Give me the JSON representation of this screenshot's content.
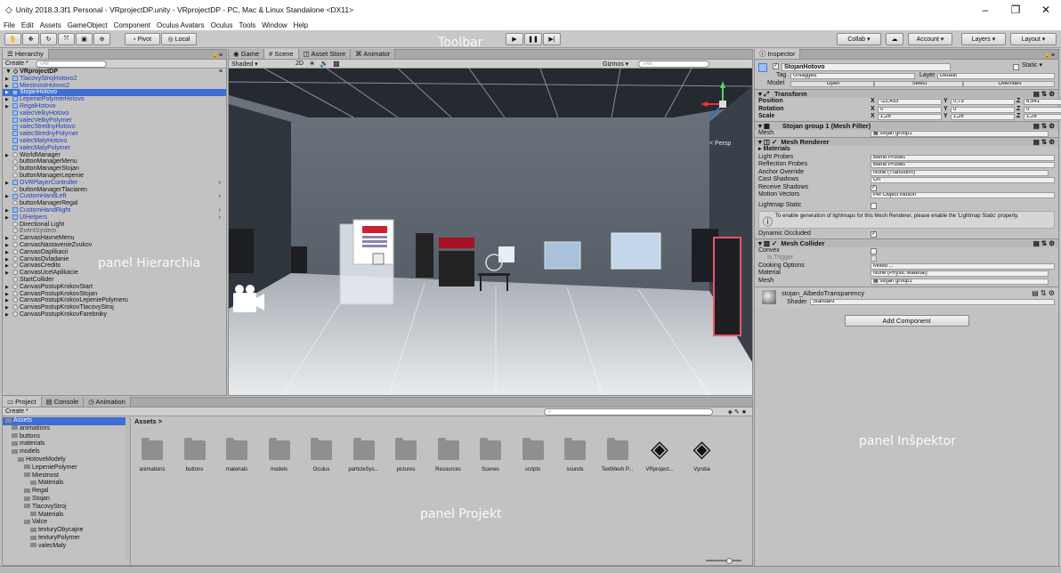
{
  "window": {
    "title": "Unity 2018.3.3f1 Personal - VRprojectDP.unity - VRprojectDP - PC, Mac & Linux Standalone <DX11>",
    "controls": [
      "–",
      "❐",
      "✕"
    ]
  },
  "menu": [
    "File",
    "Edit",
    "Assets",
    "GameObject",
    "Component",
    "Oculus Avatars",
    "Oculus",
    "Tools",
    "Window",
    "Help"
  ],
  "toolbar": {
    "pivot": "Pivot",
    "local": "Local",
    "collab": "Collab ▾",
    "account": "Account ▾",
    "layers": "Layers ▾",
    "layout": "Layout ▾"
  },
  "annotations": {
    "toolbar": "Toolbar",
    "hierarchy": "panel Hierarchia",
    "inspector": "panel Inšpektor",
    "project": "panel Projekt"
  },
  "hierarchy": {
    "tab": "Hierarchy",
    "create": "Create *",
    "search": "All",
    "scene": "VRprojectDP",
    "items": [
      {
        "label": "TlacovyStrojHotovo2",
        "style": "blue",
        "indent": 1,
        "arrow": true
      },
      {
        "label": "MiestnostHotovo2",
        "style": "blue",
        "indent": 1,
        "arrow": true
      },
      {
        "label": "StojanHotovo",
        "style": "sel",
        "indent": 1,
        "arrow": true
      },
      {
        "label": "LepeniePolymerHotovo",
        "style": "blue",
        "indent": 1,
        "arrow": true
      },
      {
        "label": "RegalHotovo",
        "style": "blue",
        "indent": 1,
        "arrow": true
      },
      {
        "label": "valecVelkyHotovo",
        "style": "blue",
        "indent": 1,
        "arrow": false
      },
      {
        "label": "valecVelkyPolymer",
        "style": "blue",
        "indent": 1,
        "arrow": false
      },
      {
        "label": "valecStrednyHotovo",
        "style": "blue",
        "indent": 1,
        "arrow": false
      },
      {
        "label": "valecStrednyPolymer",
        "style": "blue",
        "indent": 1,
        "arrow": false
      },
      {
        "label": "valecMalyHotovo",
        "style": "blue",
        "indent": 1,
        "arrow": false
      },
      {
        "label": "valecMalyPolymer",
        "style": "blue",
        "indent": 1,
        "arrow": false
      },
      {
        "label": "WorldManager",
        "style": "",
        "indent": 1,
        "arrow": true
      },
      {
        "label": "buttonManagerMenu",
        "style": "",
        "indent": 1,
        "arrow": false
      },
      {
        "label": "buttonManagerStojan",
        "style": "",
        "indent": 1,
        "arrow": false
      },
      {
        "label": "buttonManagerLepenie",
        "style": "",
        "indent": 1,
        "arrow": false
      },
      {
        "label": "OVRPlayerController",
        "style": "blue",
        "indent": 1,
        "arrow": true
      },
      {
        "label": "buttonManagerTlaciaren",
        "style": "",
        "indent": 1,
        "arrow": false
      },
      {
        "label": "CustomHandLeft",
        "style": "blue",
        "indent": 1,
        "arrow": true
      },
      {
        "label": "buttonManagerRegal",
        "style": "",
        "indent": 1,
        "arrow": false
      },
      {
        "label": "CustomHandRight",
        "style": "blue",
        "indent": 1,
        "arrow": true
      },
      {
        "label": "UIHelpers",
        "style": "blue",
        "indent": 1,
        "arrow": true
      },
      {
        "label": "Directional Light",
        "style": "",
        "indent": 1,
        "arrow": false
      },
      {
        "label": "EventSystem",
        "style": "gray",
        "indent": 1,
        "arrow": false
      },
      {
        "label": "CanvasHavneMenu",
        "style": "",
        "indent": 1,
        "arrow": true
      },
      {
        "label": "CanvasNastavenieZvukov",
        "style": "",
        "indent": 1,
        "arrow": true
      },
      {
        "label": "CanvasOaplikacii",
        "style": "",
        "indent": 1,
        "arrow": true
      },
      {
        "label": "CanvasOvladanie",
        "style": "",
        "indent": 1,
        "arrow": true
      },
      {
        "label": "CanvasCredits",
        "style": "",
        "indent": 1,
        "arrow": true
      },
      {
        "label": "CanvasUcelAplikacie",
        "style": "",
        "indent": 1,
        "arrow": true
      },
      {
        "label": "StartCollider",
        "style": "",
        "indent": 1,
        "arrow": false
      },
      {
        "label": "CanvasPostupKrokovStart",
        "style": "",
        "indent": 1,
        "arrow": true
      },
      {
        "label": "CanvasPostupKrokovStojan",
        "style": "",
        "indent": 1,
        "arrow": true
      },
      {
        "label": "CanvasPostupKrokovLepeniePolymeru",
        "style": "",
        "indent": 1,
        "arrow": true
      },
      {
        "label": "CanvasPostupKrokovTlacovyStroj",
        "style": "",
        "indent": 1,
        "arrow": true
      },
      {
        "label": "CanvasPostupKrokovFarebniky",
        "style": "",
        "indent": 1,
        "arrow": true
      }
    ]
  },
  "scene": {
    "tabs": [
      "Game",
      "Scene",
      "Asset Store",
      "Animator"
    ],
    "shading": "Shaded",
    "mode2d": "2D",
    "gizmos": "Gizmos ▾",
    "search": "All",
    "persp": "< Persp"
  },
  "inspector": {
    "tab": "Inspector",
    "object_name": "StojanHotovo",
    "static_label": "Static ▾",
    "tag_label": "Tag",
    "tag_value": "Untagged",
    "layer_label": "Layer",
    "layer_value": "Default",
    "model_label": "Model",
    "model_buttons": [
      "Open",
      "Select",
      "Overrides"
    ],
    "transform": {
      "title": "Transform",
      "rows": [
        {
          "label": "Position",
          "x": "-22,433",
          "y": "0,73",
          "z": "6,541"
        },
        {
          "label": "Rotation",
          "x": "0",
          "y": "0",
          "z": "0"
        },
        {
          "label": "Scale",
          "x": "1,26",
          "y": "1,26",
          "z": "1,26"
        }
      ]
    },
    "mesh_filter": {
      "title": "Stojan group 1 (Mesh Filter)",
      "mesh_label": "Mesh",
      "mesh_value": "stojan group1"
    },
    "mesh_renderer": {
      "title": "Mesh Renderer",
      "materials_label": "Materials",
      "rows": [
        {
          "label": "Light Probes",
          "value": "Blend Probes",
          "type": "dropdown"
        },
        {
          "label": "Reflection Probes",
          "value": "Blend Probes",
          "type": "dropdown"
        },
        {
          "label": "Anchor Override",
          "value": "None (Transform)",
          "type": "object"
        },
        {
          "label": "Cast Shadows",
          "value": "On",
          "type": "dropdown"
        },
        {
          "label": "Receive Shadows",
          "value": "✓",
          "type": "check"
        },
        {
          "label": "Motion Vectors",
          "value": "Per Object Motion",
          "type": "dropdown"
        }
      ],
      "lightmap_label": "Lightmap Static",
      "info": "To enable generation of lightmaps for this Mesh Renderer, please enable the 'Lightmap Static' property.",
      "occluded_label": "Dynamic Occluded"
    },
    "mesh_collider": {
      "title": "Mesh Collider",
      "convex_label": "Convex",
      "trigger_label": "Is Trigger",
      "cooking_label": "Cooking Options",
      "cooking_value": "Mixed ...",
      "material_label": "Material",
      "material_value": "None (Physic Material)",
      "mesh_label": "Mesh",
      "mesh_value": "stojan group1"
    },
    "material": {
      "name": "stojan_AlbedoTransparency",
      "shader_label": "Shader",
      "shader_value": "Standard"
    },
    "add_component": "Add Component"
  },
  "project": {
    "tabs": [
      "Project",
      "Console",
      "Animation"
    ],
    "create": "Create *",
    "breadcrumb": "Assets >",
    "tree": [
      {
        "label": "Assets",
        "indent": 0,
        "sel": true
      },
      {
        "label": "animations",
        "indent": 1,
        "sel": false
      },
      {
        "label": "buttons",
        "indent": 1,
        "sel": false
      },
      {
        "label": "materials",
        "indent": 1,
        "sel": false
      },
      {
        "label": "models",
        "indent": 1,
        "sel": false
      },
      {
        "label": "HotoveModely",
        "indent": 2,
        "sel": false
      },
      {
        "label": "LepeniePolymer",
        "indent": 3,
        "sel": false
      },
      {
        "label": "Miestnost",
        "indent": 3,
        "sel": false
      },
      {
        "label": "Materials",
        "indent": 4,
        "sel": false
      },
      {
        "label": "Regal",
        "indent": 3,
        "sel": false
      },
      {
        "label": "Stojan",
        "indent": 3,
        "sel": false
      },
      {
        "label": "TlacovyStroj",
        "indent": 3,
        "sel": false
      },
      {
        "label": "Materials",
        "indent": 4,
        "sel": false
      },
      {
        "label": "Valce",
        "indent": 3,
        "sel": false
      },
      {
        "label": "texturyObycajne",
        "indent": 4,
        "sel": false
      },
      {
        "label": "texturyPolymer",
        "indent": 4,
        "sel": false
      },
      {
        "label": "valecMaly",
        "indent": 4,
        "sel": false
      }
    ],
    "assets": [
      "animations",
      "buttons",
      "materials",
      "models",
      "Oculus",
      "particleSys...",
      "pictures",
      "Resources",
      "Scenes",
      "scripts",
      "sounds",
      "TextMesh P...",
      "VRproject...",
      "Vyroba"
    ]
  }
}
